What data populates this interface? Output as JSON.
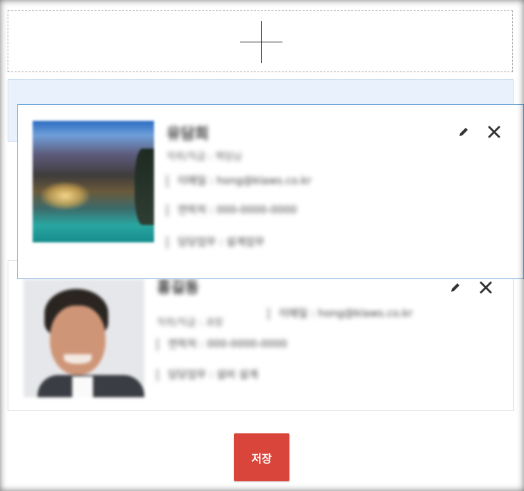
{
  "add_zone": {
    "icon": "plus-icon"
  },
  "cards": [
    {
      "name": "유담희",
      "role": "직위/직급 : 책임님",
      "email": "이메일 : hong@klaws.co.kr",
      "phone": "연락처 : 000-0000-0000",
      "duty": "담당업무 : 설계업무",
      "photo": "landscape-photo",
      "edit_icon": "pencil-icon",
      "delete_icon": "close-icon"
    },
    {
      "name": "홍길동",
      "role": "직위/직급 : 과장",
      "email": "이메일 : hong@klaws.co.kr",
      "phone": "연락처 : 000-0000-0000",
      "duty": "담당업무 : 설비 설계",
      "photo": "person-photo",
      "edit_icon": "pencil-icon",
      "delete_icon": "close-icon"
    }
  ],
  "save_button": {
    "label": "저장"
  },
  "colors": {
    "accent": "#d9453a",
    "drop_zone": "#e9f2fc",
    "drag_border": "#6fa5d8"
  }
}
